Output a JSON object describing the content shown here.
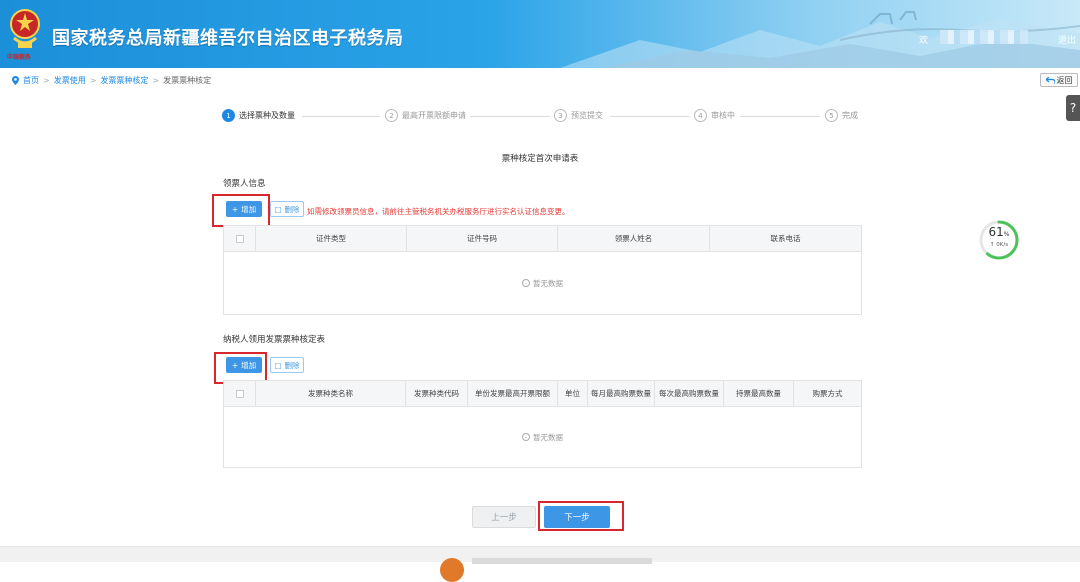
{
  "header": {
    "emblem_text": "中国税务",
    "site_title": "国家税务总局新疆维吾尔自治区电子税务局",
    "welcome": "欢",
    "logout": "退出"
  },
  "breadcrumb": {
    "items": [
      "首页",
      "发票使用",
      "发票票种核定",
      "发票票种核定"
    ]
  },
  "back_label": "返回",
  "help_label": "?",
  "steps": [
    {
      "num": "1",
      "label": "选择票种及数量",
      "active": true
    },
    {
      "num": "2",
      "label": "最高开票限额申请",
      "active": false
    },
    {
      "num": "3",
      "label": "预览提交",
      "active": false
    },
    {
      "num": "4",
      "label": "审核中",
      "active": false
    },
    {
      "num": "5",
      "label": "完成",
      "active": false
    }
  ],
  "form_title": "票种核定首次申请表",
  "section1": {
    "title": "领票人信息",
    "add_label": "增加",
    "delete_label": "删除",
    "notice": "如需修改领票员信息，请前往主管税务机关办税服务厅进行实名认证信息变更。",
    "columns": [
      "证件类型",
      "证件号码",
      "领票人姓名",
      "联系电话"
    ],
    "empty_text": "暂无数据"
  },
  "section2": {
    "title": "纳税人领用发票票种核定表",
    "add_label": "增加",
    "delete_label": "删除",
    "columns": [
      "发票种类名称",
      "发票种类代码",
      "单份发票最高开票限额",
      "单位",
      "每月最高购票数量",
      "每次最高购票数量",
      "持票最高数量",
      "购票方式"
    ],
    "empty_text": "暂无数据"
  },
  "gauge": {
    "percent": "61",
    "percent_unit": "%",
    "speed": "↑ 0K/s",
    "value": 0.61
  },
  "nav": {
    "prev_label": "上一步",
    "next_label": "下一步"
  },
  "colors": {
    "primary": "#3d97e6",
    "highlight": "#d8282e",
    "notice": "#e53935"
  }
}
